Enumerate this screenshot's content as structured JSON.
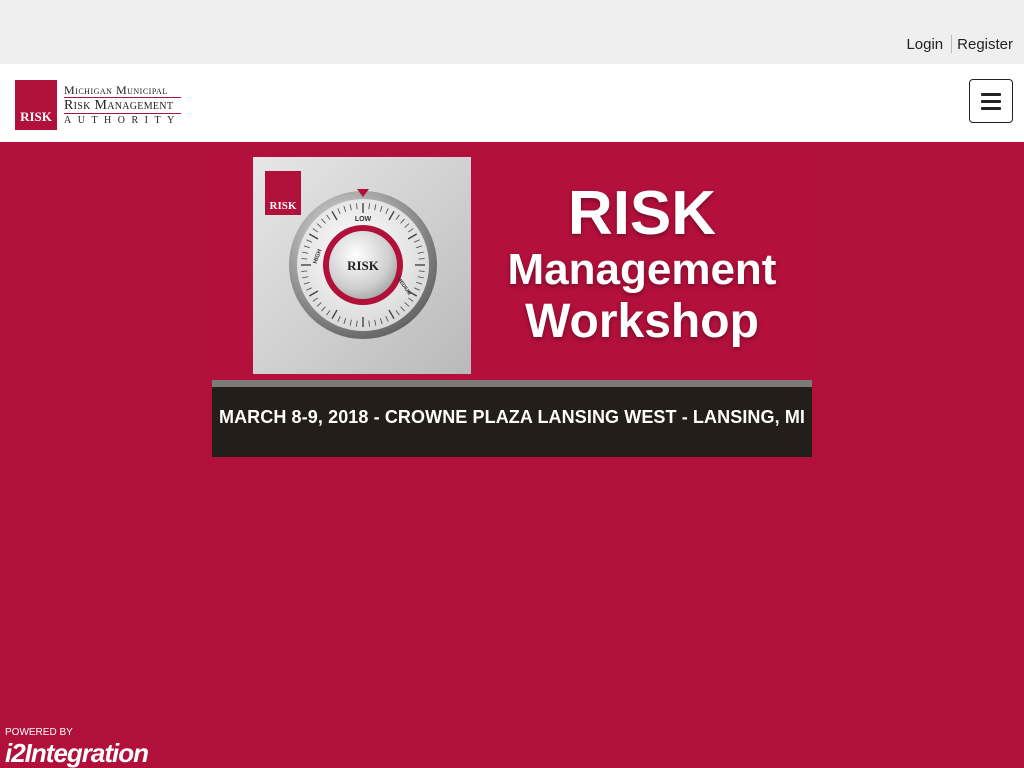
{
  "auth": {
    "login_label": "Login",
    "register_label": "Register"
  },
  "logo": {
    "badge": "RISK",
    "line1": "Michigan Municipal",
    "line2": "Risk Management",
    "line3": "AUTHORITY"
  },
  "menu": {
    "icon": "hamburger-icon"
  },
  "banner": {
    "badge": "RISK",
    "dial_center": "RISK",
    "dial_labels": [
      "LOW",
      "HIGH",
      "MEDIUM"
    ],
    "title_1": "RISK",
    "title_2": "Management",
    "title_3": "Workshop",
    "event_info": "MARCH 8-9, 2018 - CROWNE PLAZA LANSING WEST - LANSING, MI"
  },
  "footer": {
    "powered_by": "POWERED BY",
    "brand": "i2Integration"
  },
  "colors": {
    "brand_red": "#b0103a",
    "dark_bar": "#231e1a",
    "topbar_gray": "#efefef"
  }
}
